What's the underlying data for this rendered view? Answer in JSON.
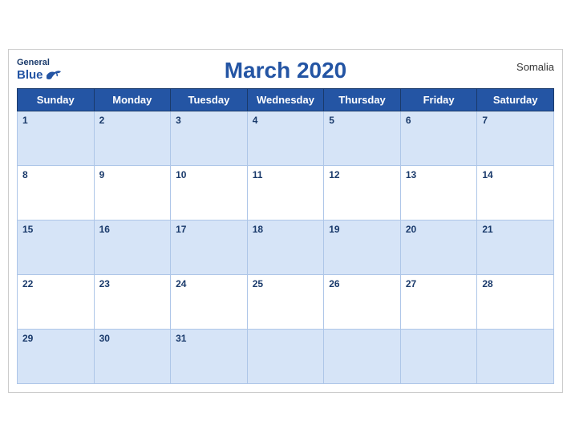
{
  "header": {
    "title": "March 2020",
    "country": "Somalia",
    "logo_general": "General",
    "logo_blue": "Blue"
  },
  "weekdays": [
    "Sunday",
    "Monday",
    "Tuesday",
    "Wednesday",
    "Thursday",
    "Friday",
    "Saturday"
  ],
  "weeks": [
    [
      1,
      2,
      3,
      4,
      5,
      6,
      7
    ],
    [
      8,
      9,
      10,
      11,
      12,
      13,
      14
    ],
    [
      15,
      16,
      17,
      18,
      19,
      20,
      21
    ],
    [
      22,
      23,
      24,
      25,
      26,
      27,
      28
    ],
    [
      29,
      30,
      31,
      null,
      null,
      null,
      null
    ]
  ]
}
